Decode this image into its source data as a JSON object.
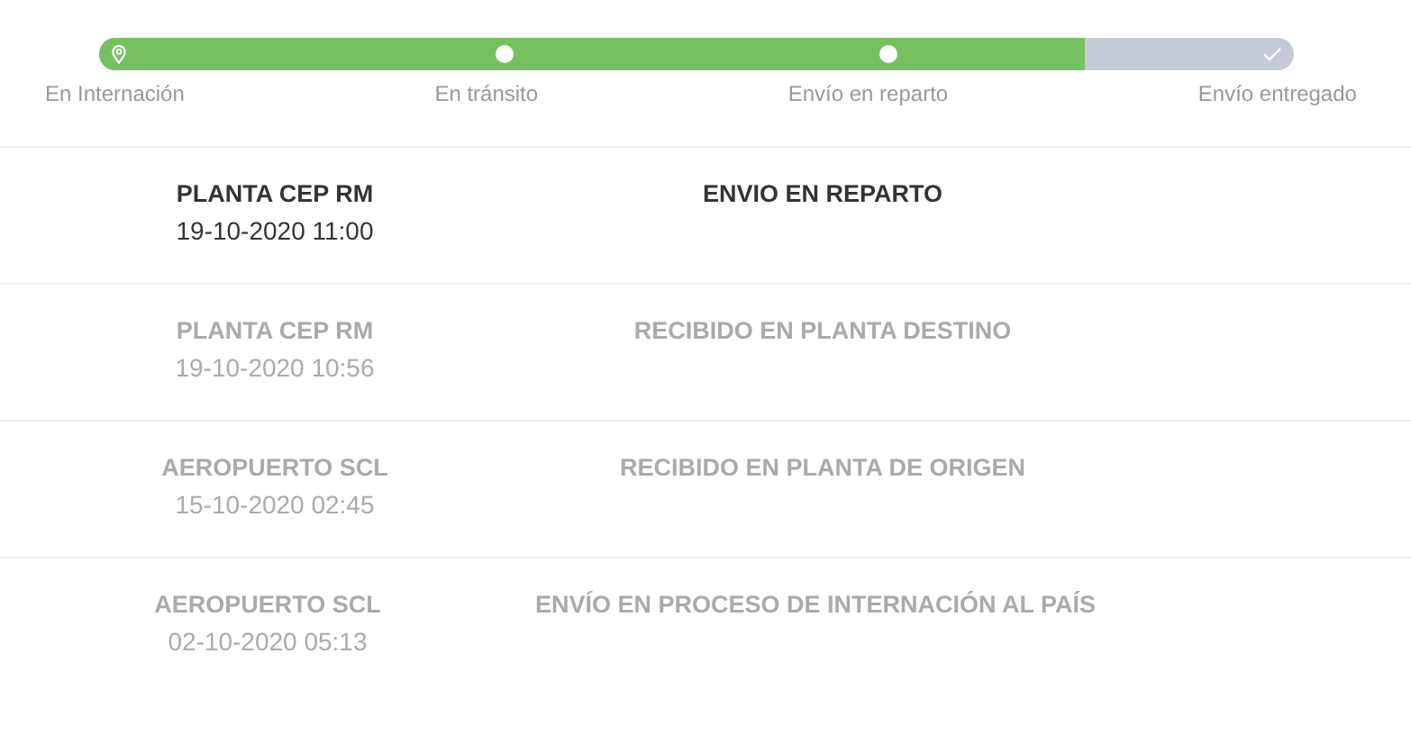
{
  "progress": {
    "level": 0.825,
    "steps": [
      {
        "label": "En Internación",
        "kind": "pin"
      },
      {
        "label": "En tránsito",
        "kind": "dot"
      },
      {
        "label": "Envío en reparto",
        "kind": "dot"
      },
      {
        "label": "Envío entregado",
        "kind": "check"
      }
    ]
  },
  "events": [
    {
      "place": "PLANTA CEP RM",
      "date": "19-10-2020 11:00",
      "status": "ENVIO EN REPARTO",
      "current": true
    },
    {
      "place": "PLANTA CEP RM",
      "date": "19-10-2020 10:56",
      "status": "RECIBIDO EN PLANTA DESTINO",
      "current": false
    },
    {
      "place": "AEROPUERTO SCL",
      "date": "15-10-2020 02:45",
      "status": "RECIBIDO EN PLANTA DE ORIGEN",
      "current": false
    },
    {
      "place": "AEROPUERTO SCL",
      "date": "02-10-2020 05:13",
      "status": "ENVÍO EN PROCESO DE INTERNACIÓN AL PAÍS",
      "current": false
    }
  ]
}
